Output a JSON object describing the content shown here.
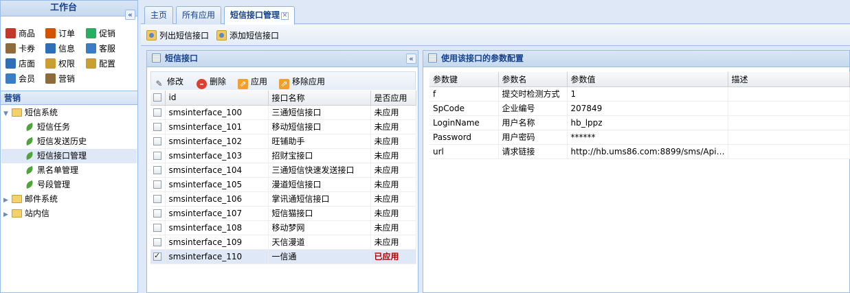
{
  "sidebar": {
    "title": "工作台",
    "quick": [
      {
        "label": "商品",
        "icon": "gift-icon",
        "color": "#c0392b"
      },
      {
        "label": "订单",
        "icon": "cart-icon",
        "color": "#d35400"
      },
      {
        "label": "促销",
        "icon": "promo-icon",
        "color": "#27ae60"
      },
      {
        "label": "卡券",
        "icon": "card-icon",
        "color": "#8e6b3a"
      },
      {
        "label": "信息",
        "icon": "info-icon",
        "color": "#2e6fb8"
      },
      {
        "label": "客服",
        "icon": "support-icon",
        "color": "#3b7dc4"
      },
      {
        "label": "店面",
        "icon": "store-icon",
        "color": "#2e6fb8"
      },
      {
        "label": "权限",
        "icon": "key-icon",
        "color": "#c9a030"
      },
      {
        "label": "配置",
        "icon": "config-icon",
        "color": "#c9a030"
      },
      {
        "label": "会员",
        "icon": "member-icon",
        "color": "#3b7dc4"
      },
      {
        "label": "营销",
        "icon": "marketing-icon",
        "color": "#8e6b3a"
      }
    ],
    "section_title": "营销",
    "tree": {
      "sms_system": "短信系统",
      "sms_children": [
        "短信任务",
        "短信发送历史",
        "短信接口管理",
        "黑名单管理",
        "号段管理"
      ],
      "mail_system": "邮件系统",
      "site_message": "站内信"
    }
  },
  "tabs": [
    "主页",
    "所有应用",
    "短信接口管理"
  ],
  "toolbar": {
    "list_label": "列出短信接口",
    "add_label": "添加短信接口"
  },
  "grid_panel": {
    "title": "短信接口",
    "actions": {
      "edit": "修改",
      "delete": "删除",
      "apply": "应用",
      "remove_apply": "移除应用"
    },
    "columns": [
      "id",
      "接口名称",
      "是否应用"
    ],
    "rows": [
      {
        "id": "smsinterface_100",
        "name": "三通短信接口",
        "status": "未应用",
        "checked": false
      },
      {
        "id": "smsinterface_101",
        "name": "移动短信接口",
        "status": "未应用",
        "checked": false
      },
      {
        "id": "smsinterface_102",
        "name": "旺铺助手",
        "status": "未应用",
        "checked": false
      },
      {
        "id": "smsinterface_103",
        "name": "招财宝接口",
        "status": "未应用",
        "checked": false
      },
      {
        "id": "smsinterface_104",
        "name": "三通短信快速发送接口",
        "status": "未应用",
        "checked": false
      },
      {
        "id": "smsinterface_105",
        "name": "漫道短信接口",
        "status": "未应用",
        "checked": false
      },
      {
        "id": "smsinterface_106",
        "name": "掌讯通短信接口",
        "status": "未应用",
        "checked": false
      },
      {
        "id": "smsinterface_107",
        "name": "短信猫接口",
        "status": "未应用",
        "checked": false
      },
      {
        "id": "smsinterface_108",
        "name": "移动梦网",
        "status": "未应用",
        "checked": false
      },
      {
        "id": "smsinterface_109",
        "name": "天信漫道",
        "status": "未应用",
        "checked": false
      },
      {
        "id": "smsinterface_110",
        "name": "一信通",
        "status": "已应用",
        "checked": true
      }
    ]
  },
  "params_panel": {
    "title": "使用该接口的参数配置",
    "columns": [
      "参数键",
      "参数名",
      "参数值",
      "描述"
    ],
    "rows": [
      {
        "key": "f",
        "name": "提交时检测方式",
        "value": "1",
        "desc": ""
      },
      {
        "key": "SpCode",
        "name": "企业编号",
        "value": "207849",
        "desc": ""
      },
      {
        "key": "LoginName",
        "name": "用户名称",
        "value": "hb_lppz",
        "desc": ""
      },
      {
        "key": "Password",
        "name": "用户密码",
        "value": "******",
        "desc": ""
      },
      {
        "key": "url",
        "name": "请求链接",
        "value": "http://hb.ums86.com:8899/sms/Api/Sen...",
        "desc": ""
      }
    ]
  }
}
